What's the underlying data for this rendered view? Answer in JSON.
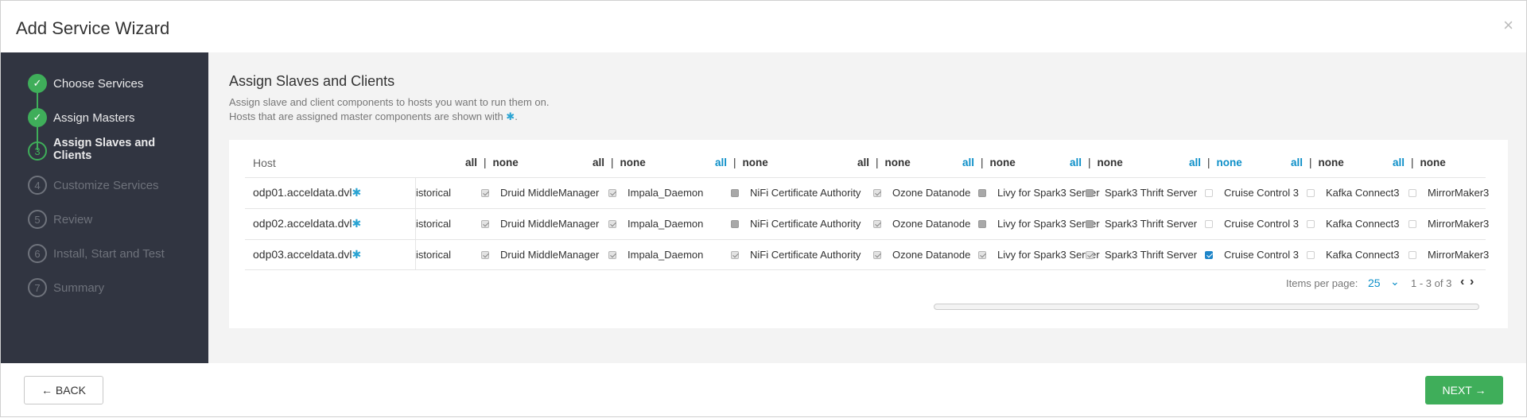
{
  "modal": {
    "title": "Add Service Wizard",
    "close": "×"
  },
  "steps": [
    {
      "number": "✓",
      "label": "Choose Services",
      "state": "done"
    },
    {
      "number": "✓",
      "label": "Assign Masters",
      "state": "done"
    },
    {
      "number": "3",
      "label": "Assign Slaves and Clients",
      "state": "current"
    },
    {
      "number": "4",
      "label": "Customize Services",
      "state": "pending"
    },
    {
      "number": "5",
      "label": "Review",
      "state": "pending"
    },
    {
      "number": "6",
      "label": "Install, Start and Test",
      "state": "pending"
    },
    {
      "number": "7",
      "label": "Summary",
      "state": "pending"
    }
  ],
  "main": {
    "title": "Assign Slaves and Clients",
    "desc_line1": "Assign slave and client components to hosts you want to run them on.",
    "desc_line2_prefix": "Hosts that are assigned master components are shown with ",
    "desc_line2_star": "✱",
    "desc_line2_suffix": "."
  },
  "table": {
    "host_header": "Host",
    "select_all": "all",
    "select_none": "none",
    "sep": "|",
    "columns": [
      {
        "name": "Historical",
        "all_blue": false,
        "none_blue": false
      },
      {
        "name": "Druid MiddleManager",
        "all_blue": false,
        "none_blue": false
      },
      {
        "name": "Impala_Daemon",
        "all_blue": false,
        "none_blue": false
      },
      {
        "name": "NiFi Certificate Authority",
        "all_blue": true,
        "none_blue": false
      },
      {
        "name": "Ozone Datanode",
        "all_blue": false,
        "none_blue": false
      },
      {
        "name": "Livy for Spark3 Server",
        "all_blue": true,
        "none_blue": false
      },
      {
        "name": "Spark3 Thrift Server",
        "all_blue": true,
        "none_blue": false
      },
      {
        "name": "Cruise Control 3",
        "all_blue": true,
        "none_blue": true
      },
      {
        "name": "Kafka Connect3",
        "all_blue": true,
        "none_blue": false
      },
      {
        "name": "MirrorMaker3",
        "all_blue": true,
        "none_blue": false
      }
    ],
    "clipped_label": "istorical",
    "rows": [
      {
        "host": "odp01.acceldata.dvl",
        "star": "✱",
        "states": [
          "checked",
          "checked",
          "filled",
          "checked",
          "filled",
          "filled",
          "empty",
          "empty",
          "empty"
        ]
      },
      {
        "host": "odp02.acceldata.dvl",
        "star": "✱",
        "states": [
          "checked",
          "checked",
          "filled",
          "checked",
          "filled",
          "filled",
          "empty",
          "empty",
          "empty"
        ]
      },
      {
        "host": "odp03.acceldata.dvl",
        "star": "✱",
        "states": [
          "checked",
          "checked",
          "checked",
          "checked",
          "checked",
          "checked",
          "blue",
          "empty",
          "empty"
        ]
      }
    ],
    "pager": {
      "label": "Items per page:",
      "value": "25",
      "range": "1 - 3 of 3"
    }
  },
  "footer": {
    "back": "← BACK",
    "next": "NEXT →"
  },
  "colors": {
    "sidebar": "#313541",
    "accent_green": "#3fae5a",
    "link_blue": "#0d8fc8"
  }
}
